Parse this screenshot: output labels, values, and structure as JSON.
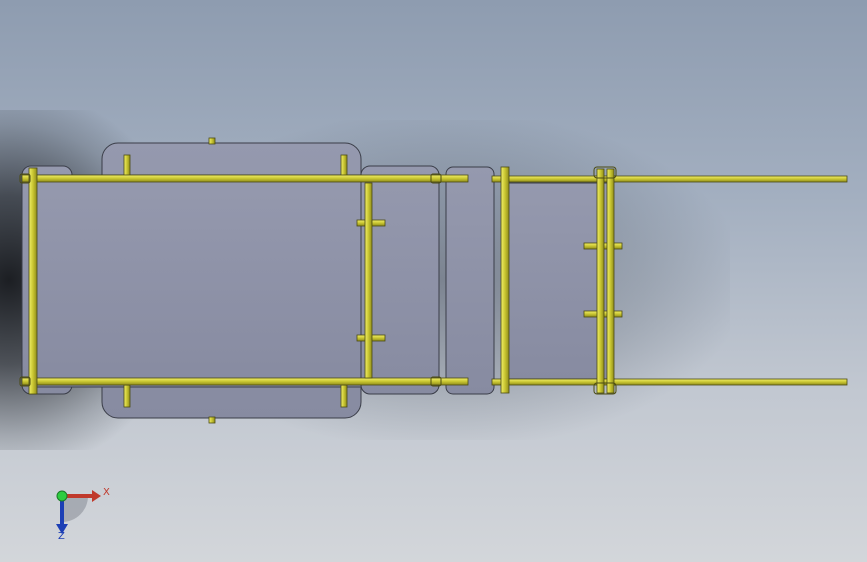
{
  "scene": {
    "background_top": "#8e9cb0",
    "background_bottom": "#d3d6da",
    "plate_color": "#8e92a8",
    "plate_edge_color": "#3a3d48",
    "rod_color": "#c9c631",
    "rod_edge_color": "#4a4a12"
  },
  "triad": {
    "x_label": "X",
    "z_label": "Z",
    "x_color": "#c0392b",
    "y_color": "#2ecc40",
    "z_color": "#1c3fb5"
  }
}
